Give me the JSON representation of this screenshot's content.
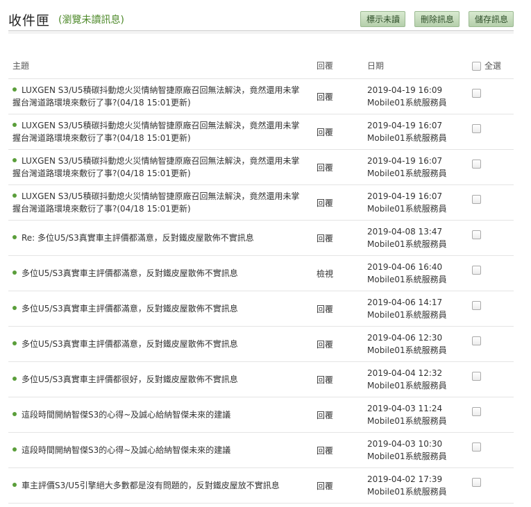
{
  "header": {
    "title": "收件匣",
    "subtitle": "(瀏覽未讀訊息)",
    "buttons": {
      "mark_unread": "標示未讀",
      "delete": "刪除訊息",
      "save": "儲存訊息"
    }
  },
  "table": {
    "columns": {
      "subject": "主題",
      "reply": "回覆",
      "date": "日期",
      "select_all": "全選"
    },
    "rows": [
      {
        "subject": "LUXGEN S3/U5積碳抖動熄火災情納智捷原廠召回無法解決，竟然還用未掌握台灣道路環境來敷衍了事?(04/18 15:01更新)",
        "action": "回覆",
        "date": "2019-04-19 16:09",
        "sender": "Mobile01系統服務員"
      },
      {
        "subject": "LUXGEN S3/U5積碳抖動熄火災情納智捷原廠召回無法解決，竟然還用未掌握台灣道路環境來敷衍了事?(04/18 15:01更新)",
        "action": "回覆",
        "date": "2019-04-19 16:07",
        "sender": "Mobile01系統服務員"
      },
      {
        "subject": "LUXGEN S3/U5積碳抖動熄火災情納智捷原廠召回無法解決，竟然還用未掌握台灣道路環境來敷衍了事?(04/18 15:01更新)",
        "action": "回覆",
        "date": "2019-04-19 16:07",
        "sender": "Mobile01系統服務員"
      },
      {
        "subject": "LUXGEN S3/U5積碳抖動熄火災情納智捷原廠召回無法解決，竟然還用未掌握台灣道路環境來敷衍了事?(04/18 15:01更新)",
        "action": "回覆",
        "date": "2019-04-19 16:07",
        "sender": "Mobile01系統服務員"
      },
      {
        "subject": "Re: 多位U5/S3真實車主評價都滿意，反對鐵皮屋散佈不實訊息",
        "action": "回覆",
        "date": "2019-04-08 13:47",
        "sender": "Mobile01系統服務員"
      },
      {
        "subject": "多位U5/S3真實車主評價都滿意，反對鐵皮屋散佈不實訊息",
        "action": "檢視",
        "date": "2019-04-06 16:40",
        "sender": "Mobile01系統服務員"
      },
      {
        "subject": "多位U5/S3真實車主評價都滿意，反對鐵皮屋散佈不實訊息",
        "action": "回覆",
        "date": "2019-04-06 14:17",
        "sender": "Mobile01系統服務員"
      },
      {
        "subject": "多位U5/S3真實車主評價都滿意，反對鐵皮屋散佈不實訊息",
        "action": "回覆",
        "date": "2019-04-06 12:30",
        "sender": "Mobile01系統服務員"
      },
      {
        "subject": "多位U5/S3真實車主評價都很好，反對鐵皮屋散佈不實訊息",
        "action": "回覆",
        "date": "2019-04-04 12:32",
        "sender": "Mobile01系統服務員"
      },
      {
        "subject": "這段時間開納智傑S3的心得~及誠心給納智傑未來的建議",
        "action": "回覆",
        "date": "2019-04-03 11:24",
        "sender": "Mobile01系統服務員"
      },
      {
        "subject": "這段時間開納智傑S3的心得~及誠心給納智傑未來的建議",
        "action": "回覆",
        "date": "2019-04-03 10:30",
        "sender": "Mobile01系統服務員"
      },
      {
        "subject": "車主評價S3/U5引擎絕大多數都是沒有問題的，反對鐵皮屋放不實訊息",
        "action": "回覆",
        "date": "2019-04-02 17:39",
        "sender": "Mobile01系統服務員"
      }
    ]
  },
  "colors": {
    "accent_green": "#5a9e3a",
    "button_bg": "#c6dcbc"
  }
}
